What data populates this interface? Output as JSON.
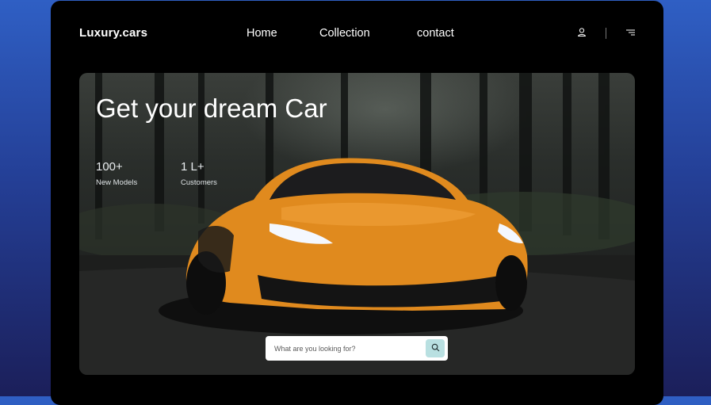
{
  "header": {
    "brand": "Luxury.cars",
    "nav": [
      "Home",
      "Collection",
      "contact"
    ],
    "icons": [
      "user-icon",
      "menu-icon"
    ]
  },
  "hero": {
    "headline": "Get your dream Car",
    "stats": [
      {
        "value": "100+",
        "label": "New  Models"
      },
      {
        "value": "1 L+",
        "label": "Customers"
      }
    ],
    "image": "orange sports car on forest road",
    "search": {
      "placeholder": "What are you looking for?",
      "icon": "search-icon"
    }
  },
  "colors": {
    "page_bg_top": "#2f5fc4",
    "page_bg_bottom": "#1b1f5a",
    "frame_bg": "#000000",
    "search_button": "#b9e0e1",
    "car": "#e08a1e"
  }
}
